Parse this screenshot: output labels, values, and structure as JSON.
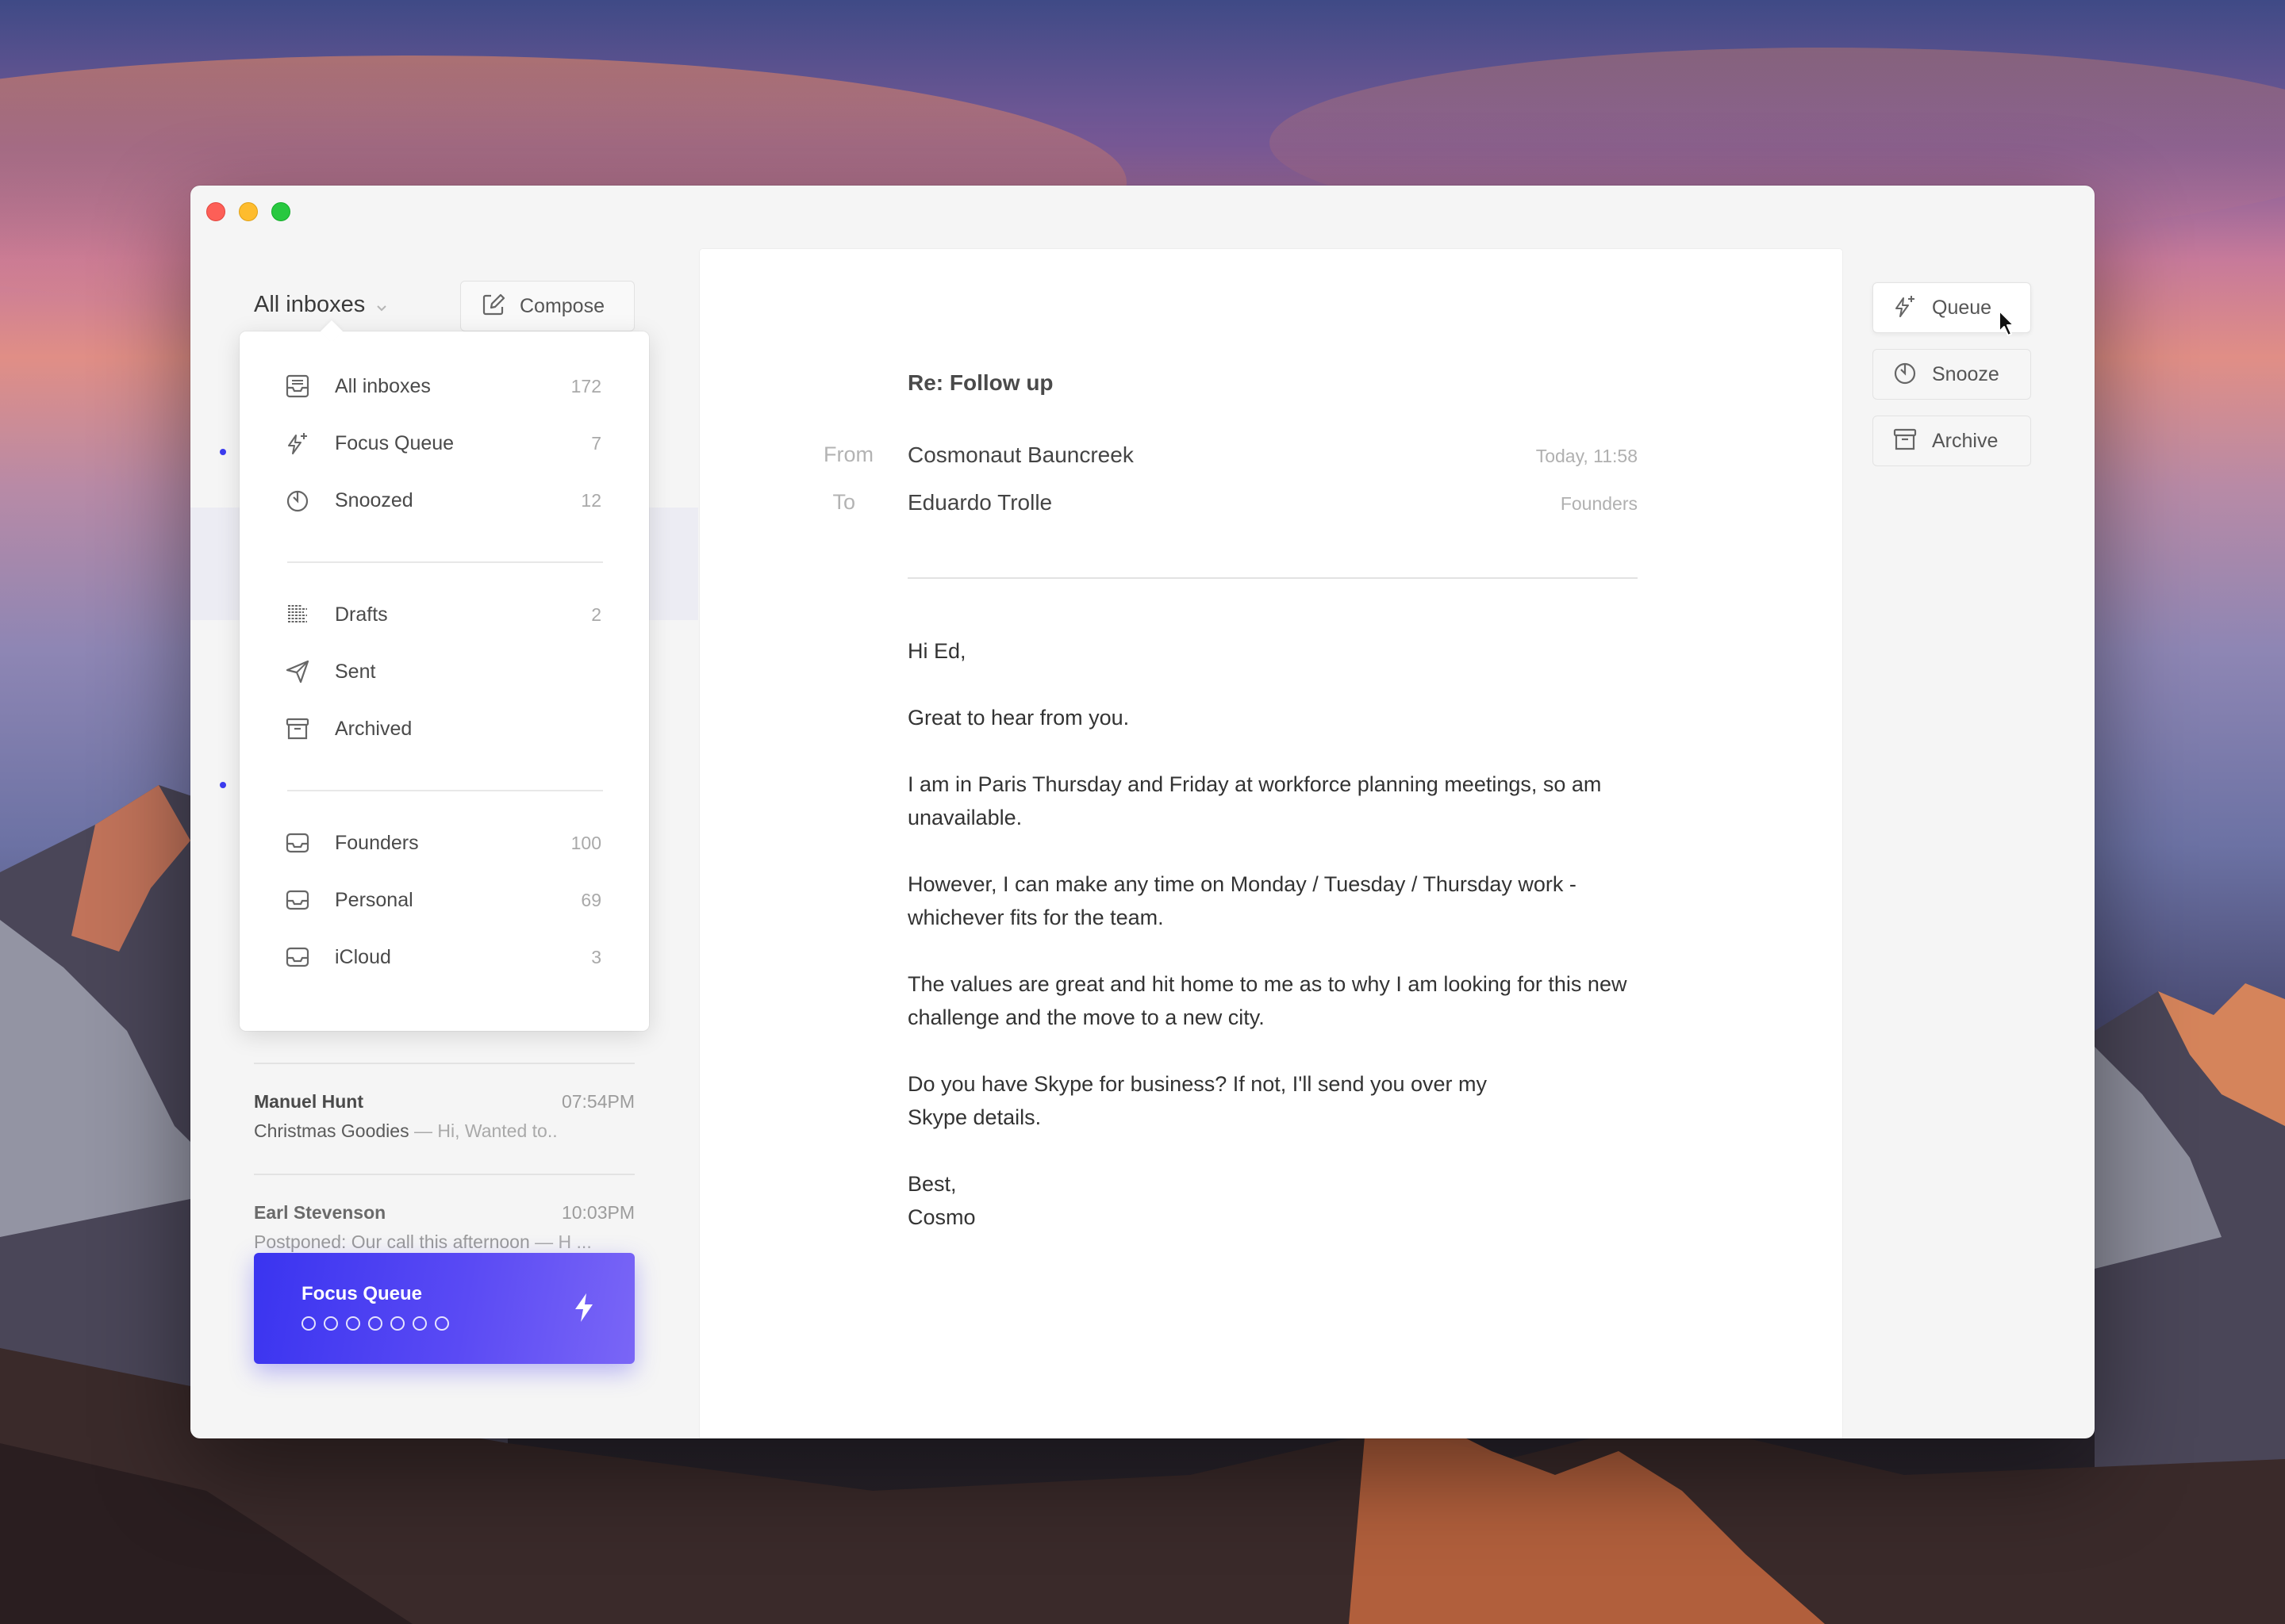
{
  "window": {
    "controls": [
      "close",
      "minimize",
      "zoom"
    ]
  },
  "sidebar": {
    "inbox_switcher": {
      "label": "All inboxes",
      "icon": "chevron-down-icon"
    },
    "compose": {
      "label": "Compose",
      "icon": "compose-icon"
    },
    "messages": [
      {
        "sender": "Manuel Hunt",
        "time": "07:54PM",
        "subject": "Christmas Goodies",
        "preview": "— Hi, Wanted to.."
      },
      {
        "sender": "Earl Stevenson",
        "time": "10:03PM",
        "subject": "Postponed: Our call this afternoon",
        "preview": "— H ..."
      }
    ],
    "focus_queue": {
      "title": "Focus Queue",
      "dots": 7,
      "icon": "bolt-icon"
    }
  },
  "dropdown": {
    "groups": [
      [
        {
          "label": "All inboxes",
          "count": "172",
          "icon": "inbox-icon"
        },
        {
          "label": "Focus Queue",
          "count": "7",
          "icon": "sparkle-bolt-icon"
        },
        {
          "label": "Snoozed",
          "count": "12",
          "icon": "timer-icon"
        }
      ],
      [
        {
          "label": "Drafts",
          "count": "2",
          "icon": "drafts-icon"
        },
        {
          "label": "Sent",
          "count": "",
          "icon": "paper-plane-icon"
        },
        {
          "label": "Archived",
          "count": "",
          "icon": "archive-icon"
        }
      ],
      [
        {
          "label": "Founders",
          "count": "100",
          "icon": "tray-icon"
        },
        {
          "label": "Personal",
          "count": "69",
          "icon": "tray-icon"
        },
        {
          "label": "iCloud",
          "count": "3",
          "icon": "tray-icon"
        }
      ]
    ]
  },
  "email": {
    "subject": "Re: Follow up",
    "from_label": "From",
    "from": "Cosmonaut Bauncreek",
    "timestamp": "Today, 11:58",
    "to_label": "To",
    "to": "Eduardo Trolle",
    "account": "Founders",
    "body": [
      "Hi Ed,",
      "Great to hear from you.",
      "I am in Paris Thursday and Friday at workforce planning meetings, so am unavailable.",
      "However, I can make any time on Monday / Tuesday / Thursday work - whichever fits for the team.",
      "The values are great and hit home to me as to why I am looking for this new challenge and the move to a new city.",
      "Do you have Skype for business? If not, I'll send you over my Skype details.",
      "Best,",
      "Cosmo"
    ]
  },
  "actions": {
    "queue": {
      "label": "Queue",
      "icon": "sparkle-bolt-icon"
    },
    "snooze": {
      "label": "Snooze",
      "icon": "timer-icon"
    },
    "archive": {
      "label": "Archive",
      "icon": "archive-icon"
    }
  },
  "colors": {
    "accent": "#3a34f0",
    "unread_dot": "#3c3cf0"
  }
}
